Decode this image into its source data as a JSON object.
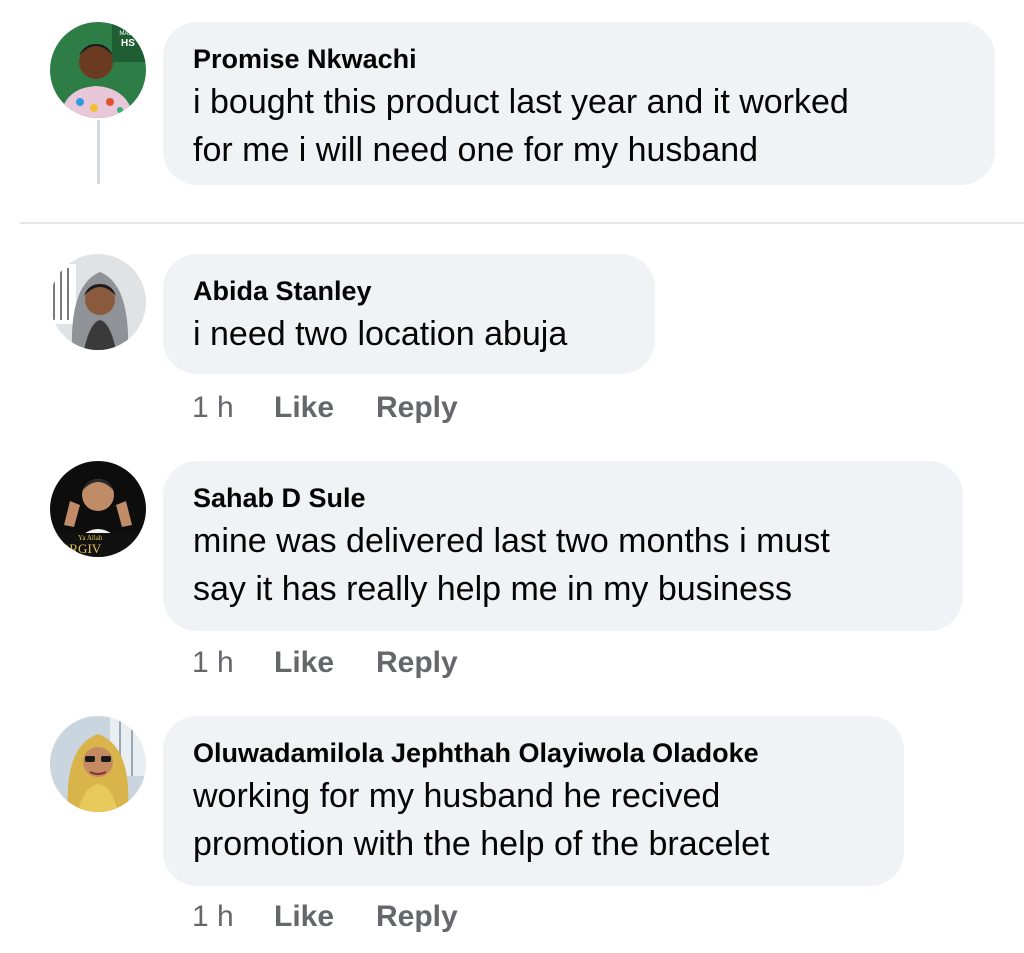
{
  "comments": [
    {
      "author": "Promise Nkwachi",
      "text_lines": [
        "i bought this product last year and it worked",
        "for me i will need one for my husband"
      ],
      "avatar_text": [
        "MADE",
        "HS"
      ]
    },
    {
      "author": "Abida Stanley",
      "text_lines": [
        "i need two location abuja"
      ],
      "time": "1 h",
      "like": "Like",
      "reply": "Reply"
    },
    {
      "author": "Sahab D Sule",
      "text_lines": [
        "mine was delivered last two months i must",
        "say it has really help me in my business"
      ],
      "time": "1 h",
      "like": "Like",
      "reply": "Reply",
      "avatar_text": [
        "Ya Allah",
        "ORGIV"
      ]
    },
    {
      "author": "Oluwadamilola Jephthah Olayiwola Oladoke",
      "text_lines": [
        "working for my husband he recived",
        "promotion with the help of the bracelet"
      ],
      "time": "1 h",
      "like": "Like",
      "reply": "Reply"
    }
  ],
  "colors": {
    "bubble": "#f0f2f5",
    "meta": "#65676b",
    "text": "#050505"
  }
}
